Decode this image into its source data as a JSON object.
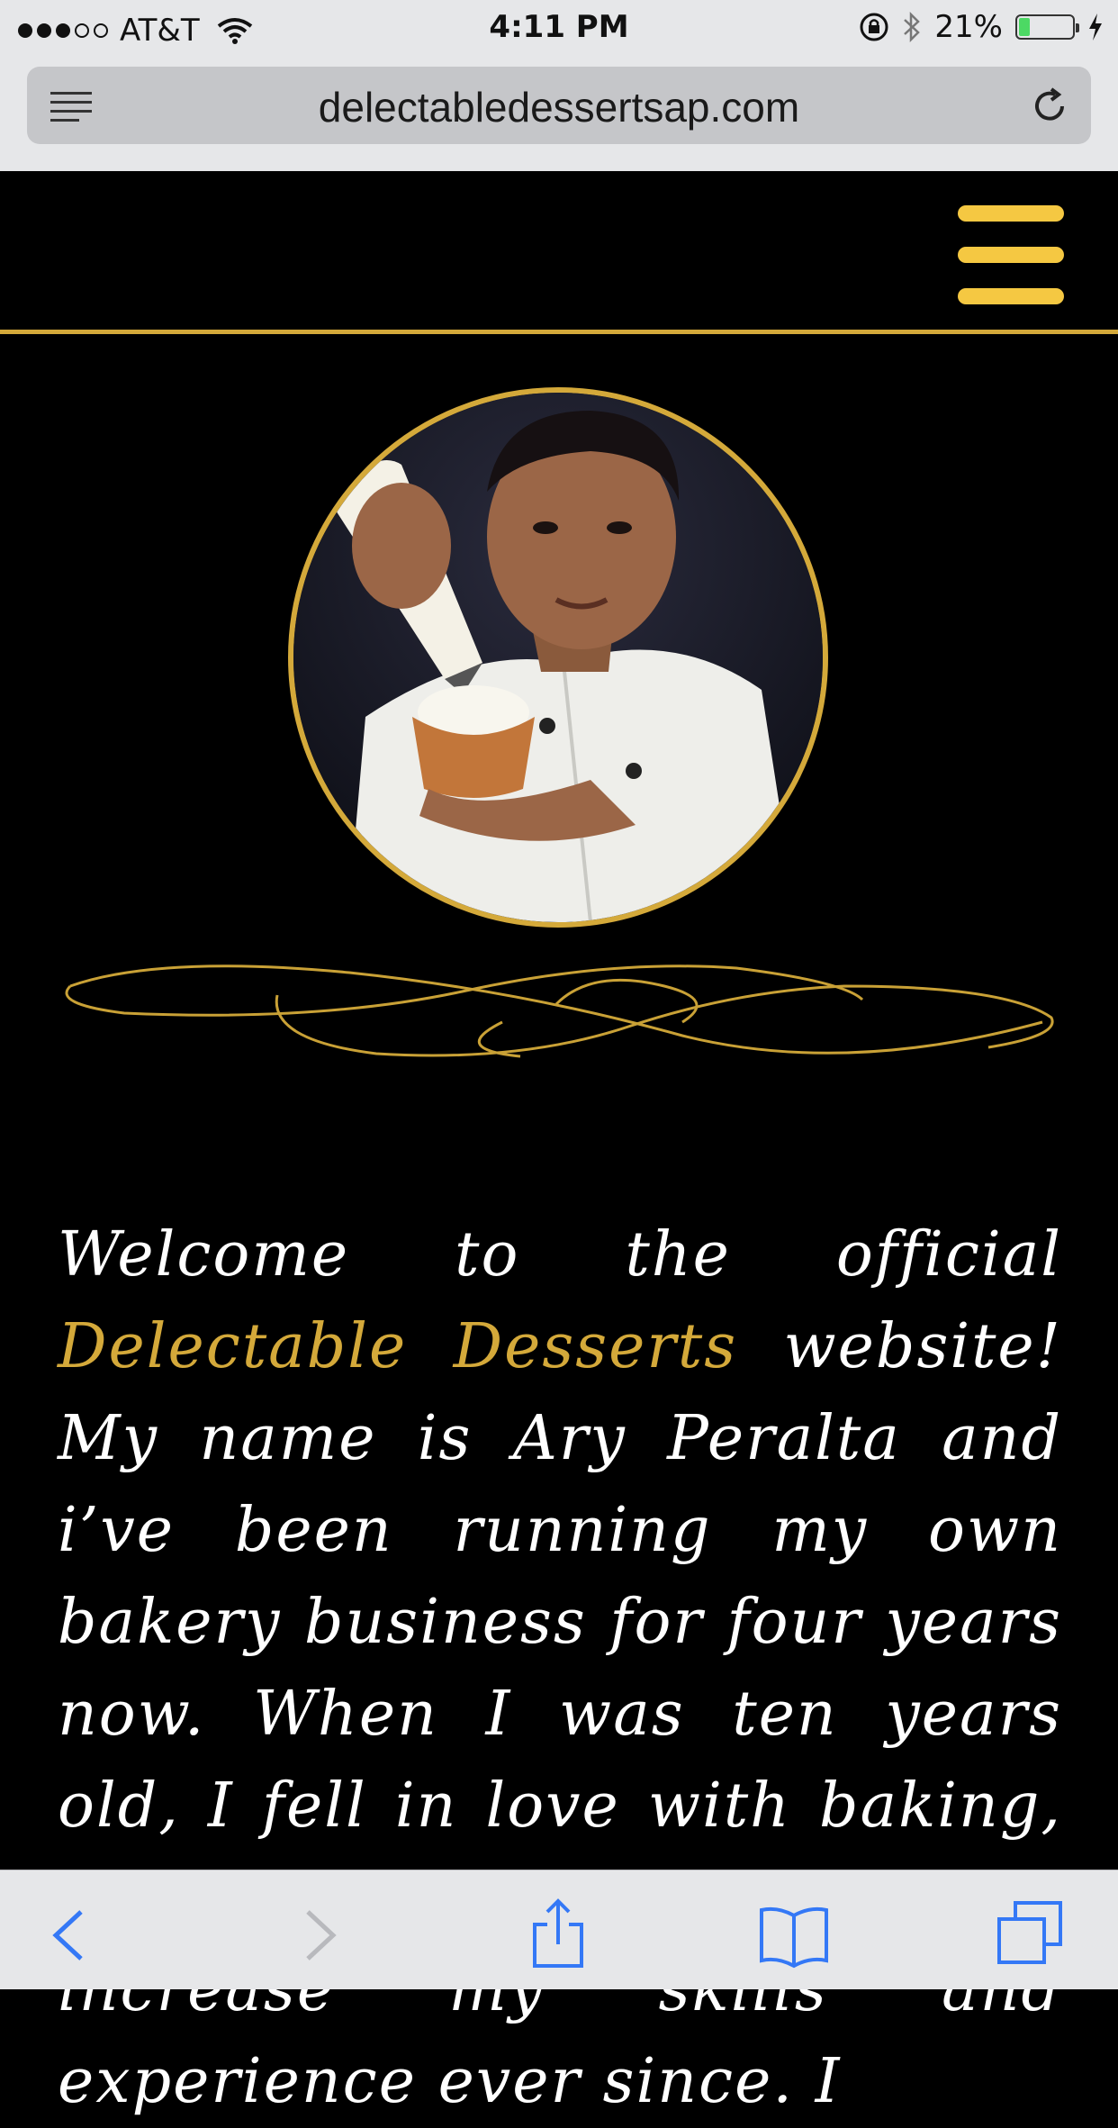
{
  "status_bar": {
    "carrier": "AT&T",
    "time": "4:11 PM",
    "battery_percent": "21%",
    "battery_level": 0.21,
    "signal_bars": 3,
    "icons": [
      "wifi-icon",
      "orientation-lock-icon",
      "bluetooth-icon",
      "charging-bolt-icon"
    ]
  },
  "browser": {
    "url": "delectabledessertsap.com",
    "icons": [
      "reader-view-icon",
      "reload-icon"
    ]
  },
  "toolbar": {
    "icons": [
      "back-icon",
      "forward-icon",
      "share-icon",
      "bookmarks-icon",
      "tabs-icon"
    ]
  },
  "site": {
    "accent_color": "#d4a93a",
    "menu_color": "#f5c842",
    "background": "#000000",
    "welcome": {
      "part1": "Welcome to the official ",
      "brand": "Delectable Desserts",
      "part2": " website! My name is Ary Peralta and i’ve been running my own bakery business for four years now. When I was ten years old, I fell in love with baking, and have been working to increase my skills and experience ever since. I"
    }
  }
}
